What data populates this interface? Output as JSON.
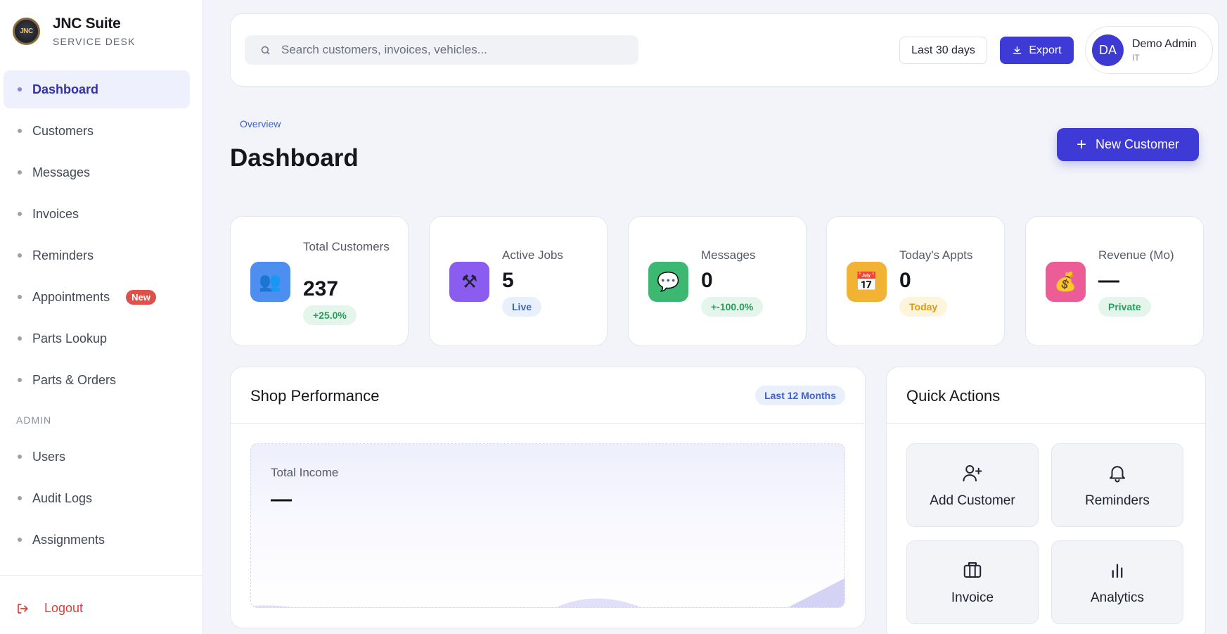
{
  "brand": {
    "name": "JNC Suite",
    "subtitle": "SERVICE DESK",
    "logo_text": "JNC"
  },
  "sidebar": {
    "items": [
      {
        "label": "Dashboard",
        "active": true
      },
      {
        "label": "Customers"
      },
      {
        "label": "Messages"
      },
      {
        "label": "Invoices"
      },
      {
        "label": "Reminders"
      },
      {
        "label": "Appointments",
        "badge": "New"
      },
      {
        "label": "Parts Lookup"
      },
      {
        "label": "Parts & Orders"
      }
    ],
    "section_label": "ADMIN",
    "admin_items": [
      {
        "label": "Users"
      },
      {
        "label": "Audit Logs"
      },
      {
        "label": "Assignments"
      }
    ],
    "logout_label": "Logout"
  },
  "topbar": {
    "search_placeholder": "Search customers, invoices, vehicles...",
    "range_label": "Last 30 days",
    "export_label": "Export",
    "user": {
      "initials": "DA",
      "name": "Demo Admin",
      "role": "IT"
    }
  },
  "header": {
    "breadcrumb": "Overview",
    "title": "Dashboard",
    "new_customer_label": "New Customer"
  },
  "stats": [
    {
      "label": "Total Customers",
      "value": "237",
      "pill": "+25.0%",
      "icon": "people-icon",
      "icon_glyph": "👥",
      "icon_color": "#4d8ef0",
      "pill_bg": "#e4f6ec",
      "pill_color": "#2e9a5d"
    },
    {
      "label": "Active Jobs",
      "value": "5",
      "pill": "Live",
      "icon": "tools-icon",
      "icon_glyph": "⚒",
      "icon_color": "#8a5cf0",
      "pill_bg": "#e8f0fb",
      "pill_color": "#3e61c4"
    },
    {
      "label": "Messages",
      "value": "0",
      "pill": "+-100.0%",
      "icon": "speech-bubble-icon",
      "icon_glyph": "💬",
      "icon_color": "#3db872",
      "pill_bg": "#e4f6ec",
      "pill_color": "#2e9a5d"
    },
    {
      "label": "Today's Appts",
      "value": "0",
      "pill": "Today",
      "icon": "calendar-icon",
      "icon_glyph": "📅",
      "icon_color": "#f2b234",
      "pill_bg": "#fdf4dc",
      "pill_color": "#d99a1a"
    },
    {
      "label": "Revenue (Mo)",
      "value": "—",
      "pill": "Private",
      "icon": "money-bag-icon",
      "icon_glyph": "💰",
      "icon_color": "#ec5d97",
      "pill_bg": "#e4f6ec",
      "pill_color": "#2e9a5d"
    }
  ],
  "performance": {
    "title": "Shop Performance",
    "badge": "Last 12 Months",
    "metric_label": "Total Income",
    "metric_value": "—"
  },
  "quick_actions": {
    "title": "Quick Actions",
    "actions": [
      {
        "label": "Add Customer",
        "icon": "user-plus-icon"
      },
      {
        "label": "Reminders",
        "icon": "bell-icon"
      },
      {
        "label": "Invoice",
        "icon": "briefcase-icon"
      },
      {
        "label": "Analytics",
        "icon": "bar-chart-icon"
      }
    ]
  },
  "colors": {
    "accent": "#3d3ad6",
    "danger": "#d7403a",
    "background": "#f3f4f9"
  }
}
